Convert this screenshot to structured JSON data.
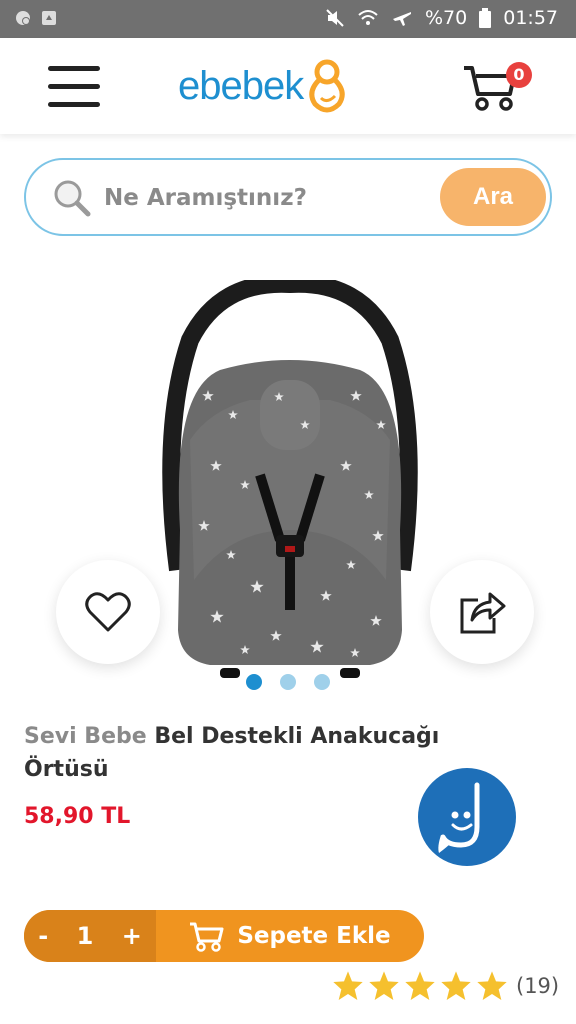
{
  "status_bar": {
    "battery": "%70",
    "time": "01:57"
  },
  "header": {
    "logo": "ebebek",
    "cart_count": "0"
  },
  "search": {
    "placeholder": "Ne Aramıştınız?",
    "button_label": "Ara"
  },
  "gallery": {
    "image_count": 3,
    "active_index": 0
  },
  "product": {
    "brand": "Sevi Bebe",
    "name": "Bel Destekli Anakucağı Örtüsü",
    "price": "58,90 TL",
    "quantity": "1",
    "qty_minus": "-",
    "qty_plus": "+",
    "add_to_cart_label": "Sepete Ekle",
    "rating_stars": 5,
    "review_count": "(19)"
  },
  "colors": {
    "brand_blue": "#1e8fd0",
    "accent_orange": "#f0941f",
    "price_red": "#e2162b",
    "star_yellow": "#f5c02e"
  }
}
